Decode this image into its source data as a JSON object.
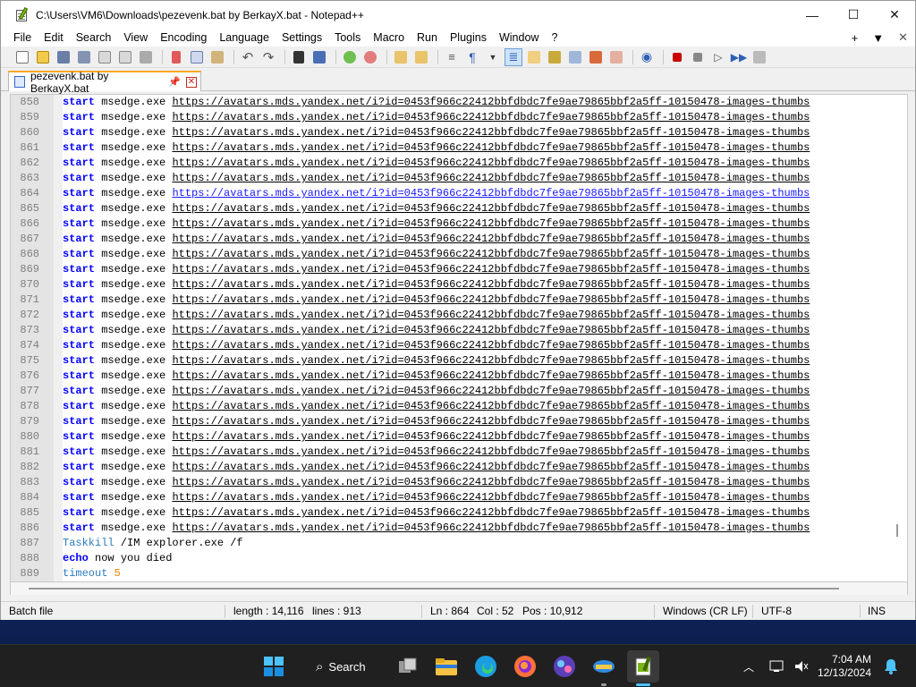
{
  "window": {
    "title": "C:\\Users\\VM6\\Downloads\\pezevenk.bat by BerkayX.bat - Notepad++",
    "minimize": "—",
    "maximize": "☐",
    "close": "✕"
  },
  "menu": {
    "items": [
      "File",
      "Edit",
      "Search",
      "View",
      "Encoding",
      "Language",
      "Settings",
      "Tools",
      "Macro",
      "Run",
      "Plugins",
      "Window",
      "?"
    ],
    "right": [
      "+",
      "▼",
      "✕"
    ]
  },
  "tab": {
    "label": "pezevenk.bat by BerkayX.bat",
    "pin": "📌",
    "close": "✕"
  },
  "editor": {
    "url_text": "https://avatars.mds.yandex.net/i?id=0453f966c22412bbfdbdc7fe9ae79865bbf2a5ff-10150478-images-thumbs",
    "start_kw": "start",
    "exe": "msedge.exe",
    "repeat_from": 858,
    "repeat_to": 886,
    "current_line": 864,
    "tail_lines": [
      {
        "num": "887",
        "a": "Taskkill",
        "b": " /IM explorer.exe /f"
      },
      {
        "num": "888",
        "a": "echo",
        "b": " now you died"
      },
      {
        "num": "889",
        "a": "timeout",
        "b": " 5"
      }
    ]
  },
  "status": {
    "type": "Batch file",
    "length": "length : 14,116",
    "lines": "lines : 913",
    "ln": "Ln : 864",
    "col": "Col : 52",
    "pos": "Pos : 10,912",
    "eol": "Windows (CR LF)",
    "encoding": "UTF-8",
    "mode": "INS"
  },
  "taskbar": {
    "search_label": "Search",
    "time": "7:04 AM",
    "date": "12/13/2024"
  },
  "colors": {
    "keyword": "#0000ff",
    "command": "#2b7bbf",
    "number": "#ff7f00",
    "tab_accent": "#f9a825"
  }
}
